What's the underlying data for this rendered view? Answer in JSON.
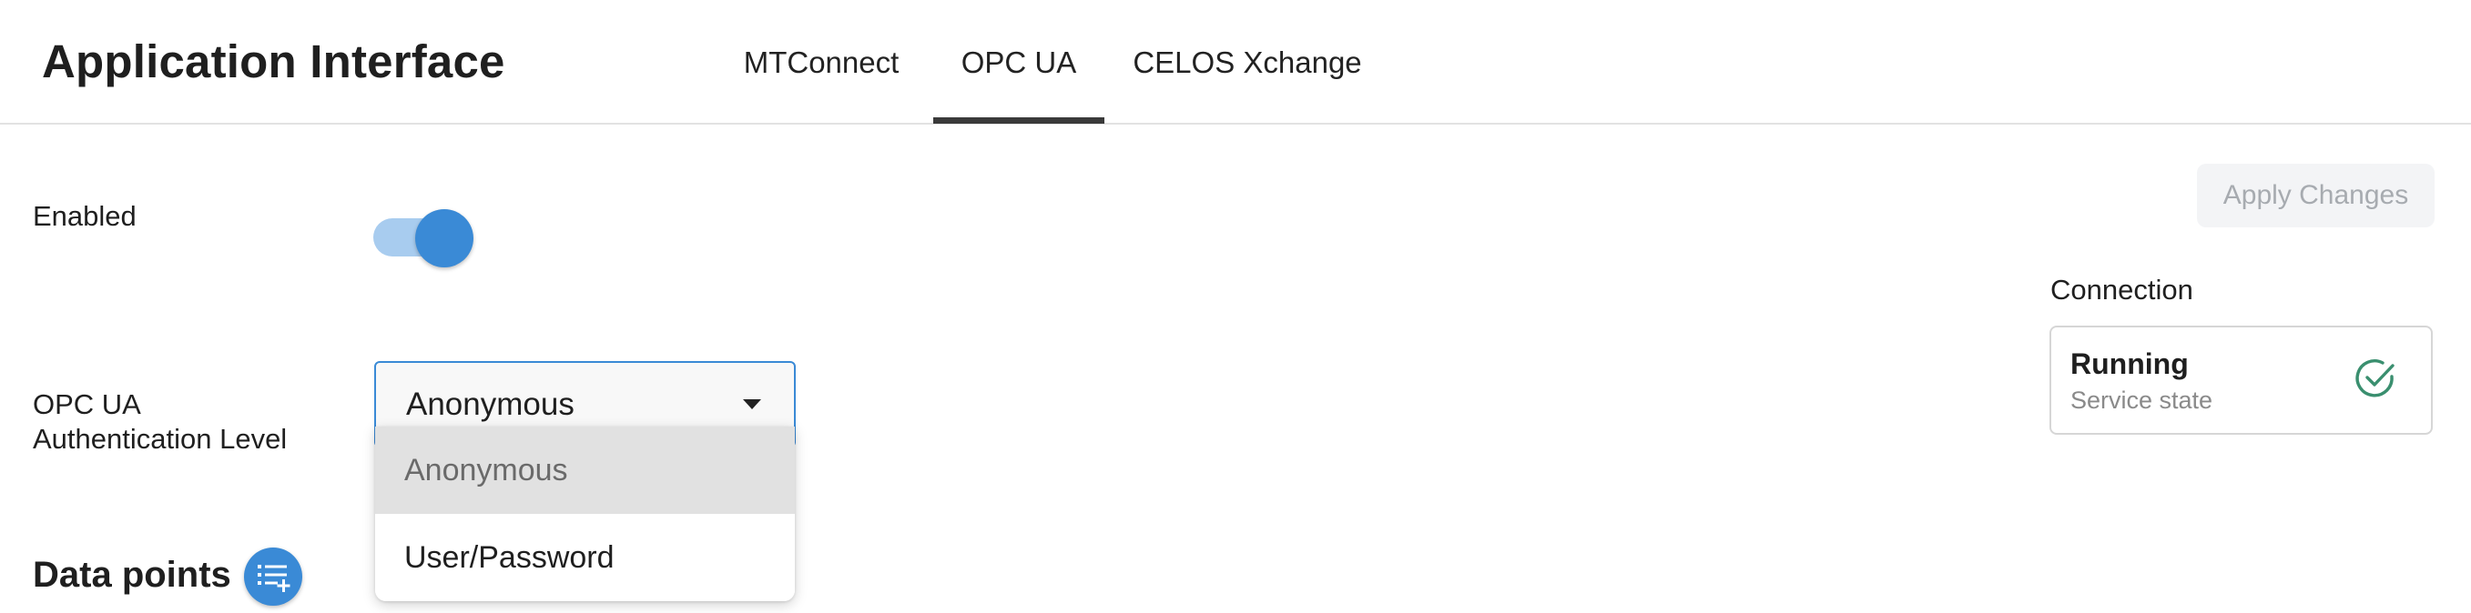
{
  "header": {
    "title": "Application Interface",
    "tabs": [
      {
        "label": "MTConnect",
        "active": false
      },
      {
        "label": "OPC UA",
        "active": true
      },
      {
        "label": "CELOS Xchange",
        "active": false
      }
    ]
  },
  "toolbar": {
    "apply_label": "Apply Changes"
  },
  "settings": {
    "enabled_label": "Enabled",
    "enabled_value": true,
    "auth_label_line1": "OPC UA",
    "auth_label_line2": "Authentication Level",
    "auth_selected": "Anonymous",
    "auth_options": [
      "Anonymous",
      "User/Password"
    ]
  },
  "data_points": {
    "title": "Data points",
    "add_icon": "playlist-add-icon"
  },
  "connection": {
    "label": "Connection",
    "state": "Running",
    "state_sub": "Service state",
    "state_icon": "check-circle-icon"
  },
  "colors": {
    "accent": "#3a8ad6",
    "toggle_track": "#a8ccef",
    "status_ok": "#3a8f6f"
  }
}
